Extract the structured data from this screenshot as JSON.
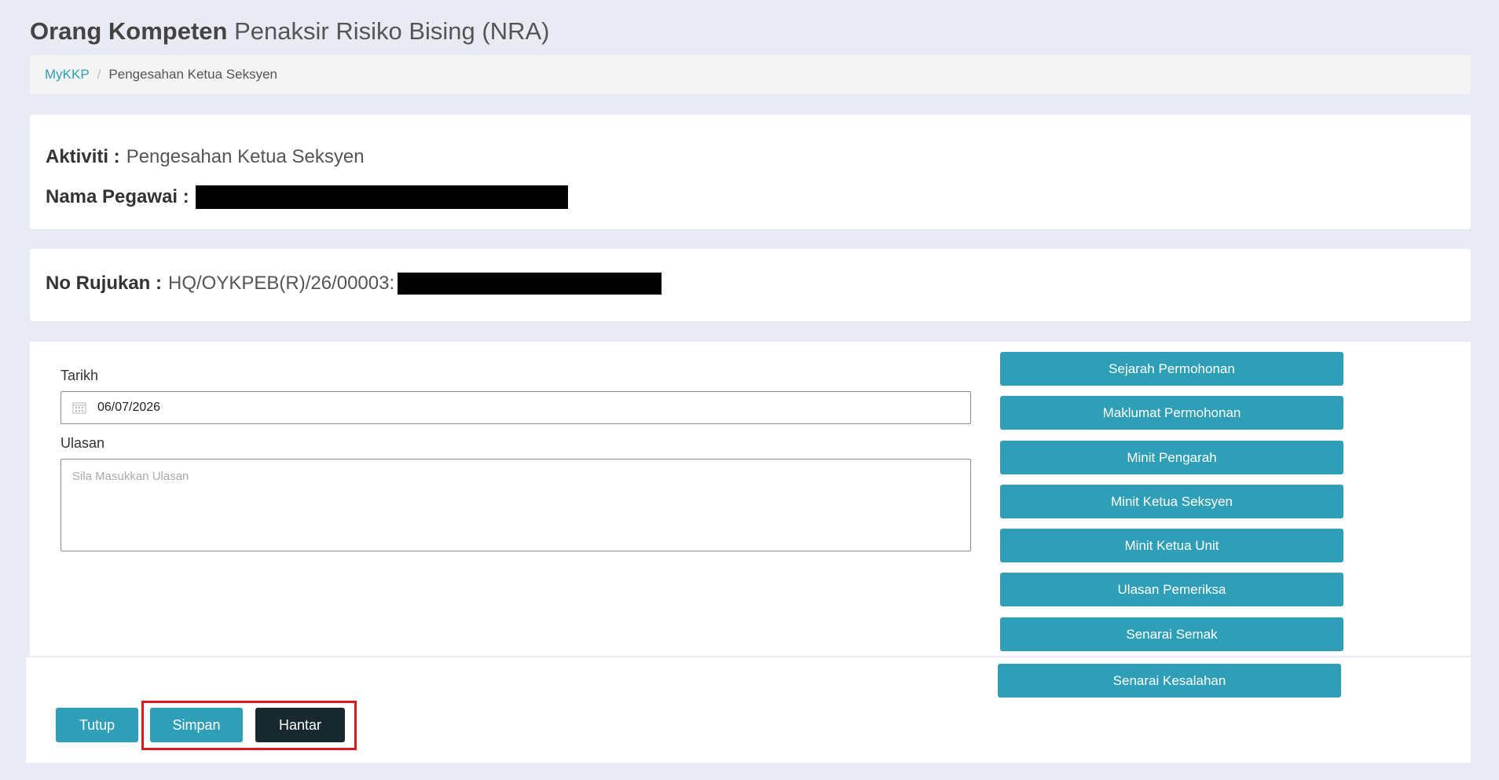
{
  "header": {
    "title_strong": "Orang Kompeten",
    "title_light": "Penaksir Risiko Bising (NRA)"
  },
  "breadcrumb": {
    "home": "MyKKP",
    "separator": "/",
    "current": "Pengesahan Ketua Seksyen"
  },
  "activity": {
    "label": "Aktiviti :",
    "value": "Pengesahan Ketua Seksyen"
  },
  "employee": {
    "label": "Nama Pegawai :"
  },
  "reference": {
    "label": "No Rujukan :",
    "value": "HQ/OYKPEB(R)/26/00003:"
  },
  "form": {
    "date_label": "Tarikh",
    "date_value": "06/07/2026",
    "comment_label": "Ulasan",
    "comment_placeholder": "Sila Masukkan Ulasan"
  },
  "side_menu": [
    {
      "label": "Sejarah Permohonan"
    },
    {
      "label": "Maklumat Permohonan"
    },
    {
      "label": "Minit Pengarah"
    },
    {
      "label": "Minit Ketua Seksyen"
    },
    {
      "label": "Minit Ketua Unit"
    },
    {
      "label": "Ulasan Pemeriksa"
    },
    {
      "label": "Senarai Semak"
    },
    {
      "label": "Senarai Kesalahan"
    }
  ],
  "actions": {
    "close_label": "Tutup",
    "save_label": "Simpan",
    "send_label": "Hantar"
  },
  "colors": {
    "accent": "#2e9fb7",
    "dark_button": "#17282f",
    "highlight": "#d71920",
    "background": "#e9ebf4"
  },
  "icons": {
    "date_field": "calendar-icon"
  }
}
